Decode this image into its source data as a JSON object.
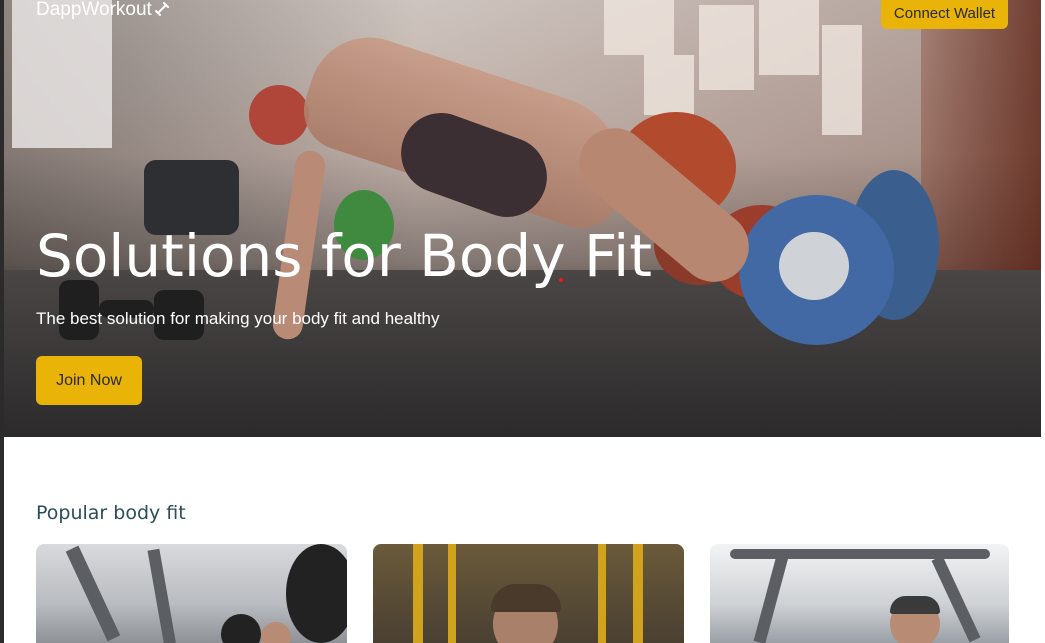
{
  "brand": {
    "name": "DappWorkout",
    "icon": "dumbbell-icon"
  },
  "header": {
    "connect_label": "Connect Wallet"
  },
  "hero": {
    "title": "Solutions for Body Fit",
    "subtitle": "The best solution for making your body fit and healthy",
    "cta_label": "Join Now"
  },
  "popular": {
    "title": "Popular body fit",
    "cards": [
      {
        "image": "bench-press-photo"
      },
      {
        "image": "cable-fly-photo"
      },
      {
        "image": "machine-workout-photo"
      }
    ]
  },
  "colors": {
    "accent": "#eab308",
    "section_title": "#2a4e5c",
    "button_text": "#2a2a2a"
  }
}
